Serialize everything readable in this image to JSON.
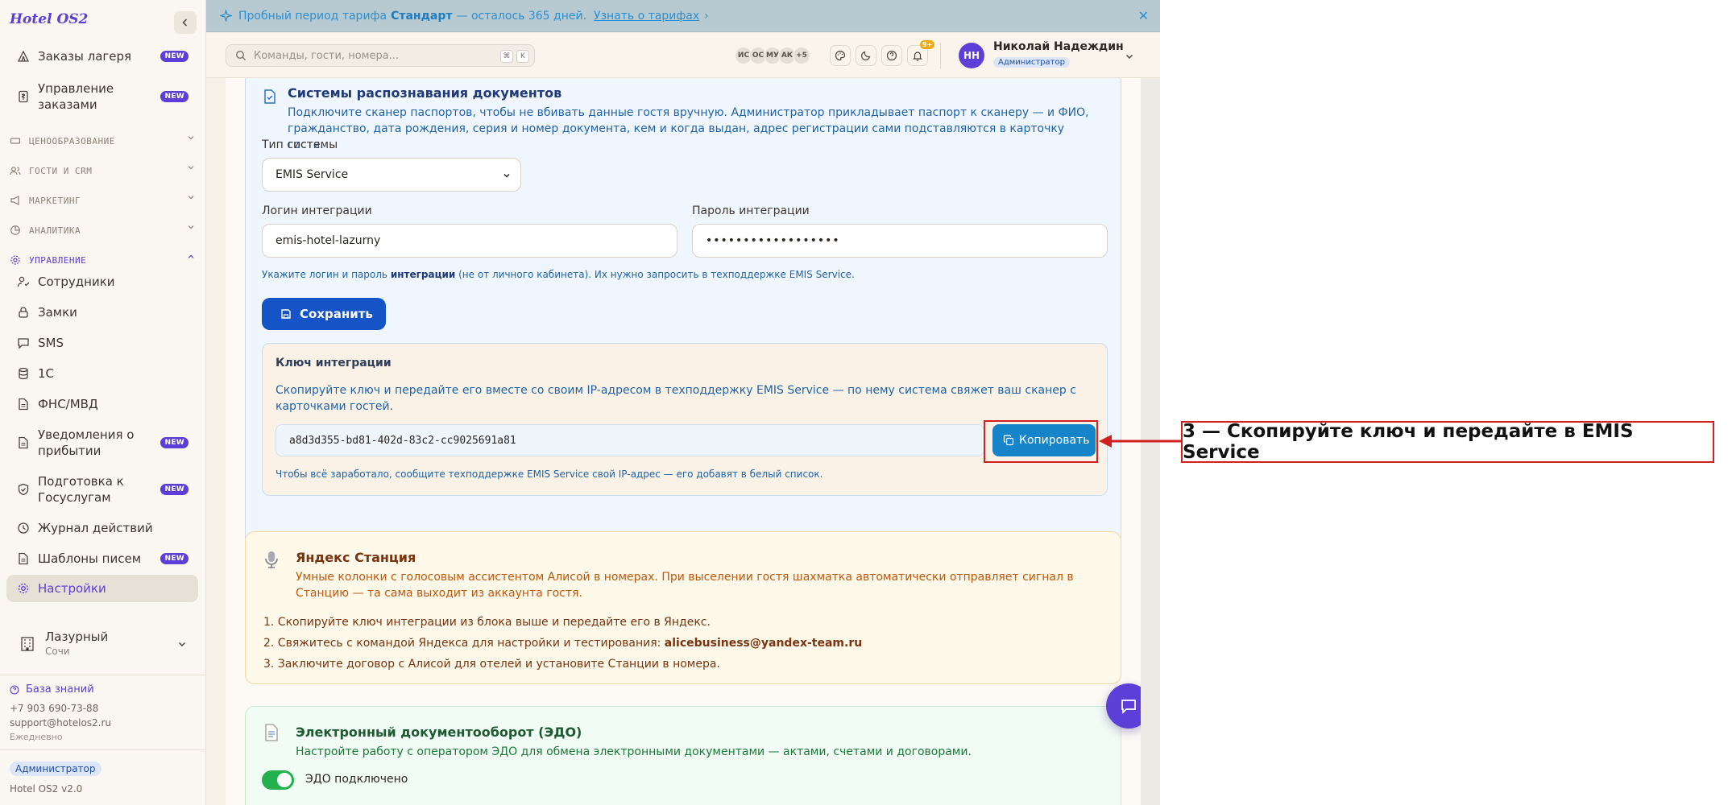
{
  "sidebar": {
    "logo": "Hotel OS2",
    "items_top": [
      {
        "label": "Заказы лагеря",
        "badge": "NEW"
      },
      {
        "label": "Управление заказами",
        "badge": "NEW"
      }
    ],
    "sections": [
      {
        "label": "ЦЕНООБРАЗОВАНИЕ"
      },
      {
        "label": "ГОСТИ И CRM"
      },
      {
        "label": "МАРКЕТИНГ"
      },
      {
        "label": "АНАЛИТИКА"
      },
      {
        "label": "УПРАВЛЕНИЕ"
      }
    ],
    "items": [
      {
        "label": "Сотрудники"
      },
      {
        "label": "Замки"
      },
      {
        "label": "SMS"
      },
      {
        "label": "1С"
      },
      {
        "label": "ФНС/МВД"
      },
      {
        "label": "Уведомления о прибытии",
        "badge": "NEW"
      },
      {
        "label": "Подготовка к Госуслугам",
        "badge": "NEW"
      },
      {
        "label": "Журнал действий"
      },
      {
        "label": "Шаблоны писем",
        "badge": "NEW"
      },
      {
        "label": "Настройки"
      }
    ],
    "hotel": {
      "name": "Лазурный",
      "city": "Сочи"
    },
    "knowledge_base": "База знаний",
    "phone": "+7 903 690-73-88",
    "email": "support@hotelos2.ru",
    "schedule": "Ежедневно",
    "role": "Администратор",
    "version": "Hotel OS2 v2.0"
  },
  "banner": {
    "text_pre": "Пробный период тарифа",
    "plan": "Стандарт",
    "text_post": "— осталось 365 дней.",
    "link": "Узнать о тарифах"
  },
  "topbar": {
    "search_placeholder": "Команды, гости, номера...",
    "kbd1": "⌘",
    "kbd2": "K",
    "avatars": [
      "ИС",
      "ОС",
      "МУ",
      "АК"
    ],
    "more": "+5",
    "notif_count": "9+",
    "user": {
      "initials": "НН",
      "name": "Николай Надеждин",
      "role": "Администратор"
    }
  },
  "doc_scan": {
    "title": "Системы распознавания документов",
    "desc": "Подключите сканер паспортов, чтобы не вбивать данные гостя вручную. Администратор прикладывает паспорт к сканеру — и ФИО, гражданство, дата рождения, серия и номер документа, кем и когда выдан, адрес регистрации сами подставляются в карточку гостя.",
    "system_label": "Тип системы",
    "system_value": "EMIS Service",
    "login_label": "Логин интеграции",
    "login_value": "emis-hotel-lazurny",
    "password_label": "Пароль интеграции",
    "password_value": "••••••••••••••••••",
    "hint_pre": "Укажите логин и пароль",
    "hint_bold": "интеграции",
    "hint_post": "(не от личного кабинета). Их нужно запросить в техподдержке EMIS Service.",
    "save_label": "Сохранить",
    "key": {
      "title": "Ключ интеграции",
      "desc": "Скопируйте ключ и передайте его вместе со своим IP-адресом в техподдержку EMIS Service — по нему система свяжет ваш сканер с карточками гостей.",
      "value": "a8d3d355-bd81-402d-83c2-cc9025691a81",
      "copy_label": "Копировать",
      "note": "Чтобы всё заработало, сообщите техподдержке EMIS Service свой IP-адрес — его добавят в белый список."
    }
  },
  "yandex": {
    "title": "Яндекс Станция",
    "desc": "Умные колонки с голосовым ассистентом Алисой в номерах. При выселении гостя шахматка автоматически отправляет сигнал в Станцию — та сама выходит из аккаунта гостя.",
    "steps": [
      "1. Скопируйте ключ интеграции из блока выше и передайте его в Яндекс.",
      "2. Свяжитесь с командой Яндекса для настройки и тестирования:",
      "3. Заключите договор с Алисой для отелей и установите Станции в номера."
    ],
    "email": "alicebusiness@yandex-team.ru"
  },
  "edo": {
    "title": "Электронный документооборот (ЭДО)",
    "desc": "Настройте работу с оператором ЭДО для обмена электронными документами — актами, счетами и договорами.",
    "toggle_label": "ЭДО подключено"
  },
  "annotation": {
    "text": "3 — Скопируйте ключ и передайте в EMIS Service",
    "color": "#d21f1f"
  }
}
